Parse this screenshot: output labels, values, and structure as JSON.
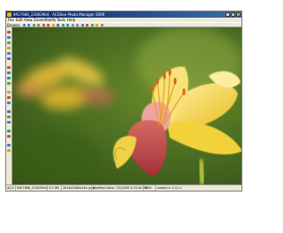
{
  "window": {
    "title": "IMG7686_22083904 - ACDSee Photo Manager 2009"
  },
  "title_controls": [
    "_",
    "□",
    "x"
  ],
  "menu": [
    "File",
    "Edit",
    "View",
    "Zoom",
    "Modify",
    "Tools",
    "Help"
  ],
  "toolbar": {
    "browse_label": "Browse"
  },
  "status": {
    "index": "4/13",
    "filename": "IMG7686_22083904",
    "filesize": "3.5 MB",
    "dimensions": "2816x2080x24b jpeg",
    "modified": "Modified Date: 7/2/2009 4:23:16 PM",
    "zoom": "26%",
    "load": "Loaded in 0.11 s"
  },
  "colors": {
    "titlebar": "#0a246a",
    "photo_background": "#4f7222",
    "petal_yellow": "#f2d23a",
    "petal_red": "#b8434d",
    "stamen_orange": "#e58a12"
  }
}
